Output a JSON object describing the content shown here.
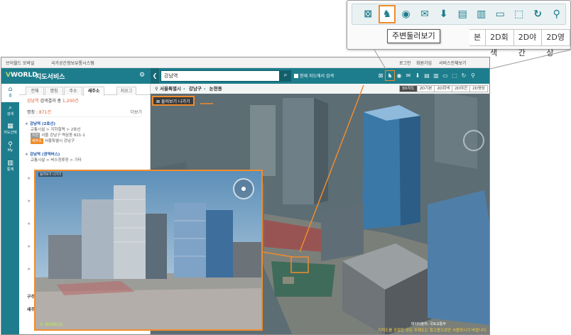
{
  "zoom_callout": {
    "icons": [
      "roadview-icon",
      "surround-view-icon",
      "measure-icon",
      "mail-icon",
      "download-icon",
      "print-icon",
      "building-icon",
      "ruler-icon",
      "area-icon",
      "refresh-icon",
      "location-pin-icon"
    ],
    "active_icon": "surround-view-icon",
    "tooltip": "주변둘러보기",
    "map_types": [
      "본",
      "2D회색",
      "2D야간",
      "2D영상"
    ]
  },
  "top_bar": {
    "mobile_link": "브이월드 모바일",
    "national_link": "국가공간정보유통시스템",
    "login": "로그인",
    "signup": "회원가입",
    "all_services": "서비스전체보기"
  },
  "header": {
    "logo_v": "V",
    "logo_rest": "WORLD",
    "service_title": "지도서비스",
    "search_value": "강남역",
    "current_map_search": "현재 지도에서 검색"
  },
  "rail": [
    {
      "icon": "home-icon",
      "label": "홈"
    },
    {
      "icon": "search-icon",
      "label": "검색"
    },
    {
      "icon": "theme-map-icon",
      "label": "지도선택"
    },
    {
      "icon": "my-icon",
      "label": "My"
    },
    {
      "icon": "stats-icon",
      "label": "통계"
    }
  ],
  "panel": {
    "tabs": [
      "전체",
      "명칭",
      "주소",
      "새주소",
      "지오그"
    ],
    "result_keyword": "강남역",
    "result_text": "검색결과 총",
    "result_count": "1,200건",
    "category": "명칭",
    "category_count": "871건",
    "more": "더보기",
    "results": [
      {
        "name": "강남역 (2호선)",
        "category": "교통시설 > 지하철역 > 2호선",
        "jibun_badge": "지번",
        "jibun": "서울 강남구 역삼동 821-1",
        "road_badge": "새주소",
        "road": "서울특별시 강남구"
      },
      {
        "name": "강남역 (광역버스)",
        "category": "교통시설 > 버스정류장 > 기타"
      }
    ],
    "footer1": "구주",
    "footer2": "새주"
  },
  "map": {
    "breadcrumb": [
      "서울특별시",
      "강남구",
      "논현동"
    ],
    "type_tabs": [
      "3D지도",
      "2D기본",
      "2D회색",
      "2D야간",
      "2D영상"
    ],
    "active_type": "3D지도",
    "exit_roadview": "둘러보기 나가기",
    "notice": "지적도를 포함한 모든 주제도는 참고용으로만 사용하시기 바랍니다.",
    "scale": "데이터출처: 국토교통부"
  },
  "roadview": {
    "label": "둘러보기 나가기",
    "logo": "V WORLD"
  },
  "colors": {
    "brand_teal": "#1d7d8c",
    "highlight_orange": "#f08c2c",
    "accent_red": "#e2582c"
  }
}
